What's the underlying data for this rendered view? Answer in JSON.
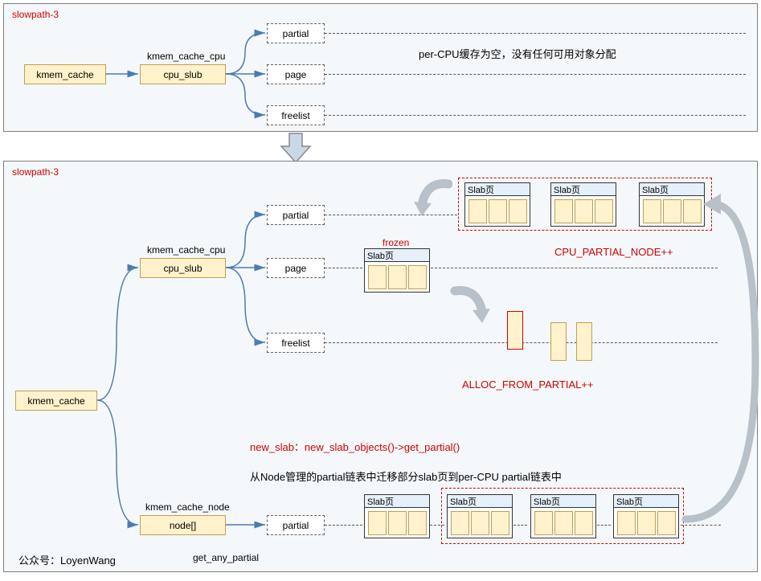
{
  "top": {
    "title": "slowpath-3",
    "kmem_cache": "kmem_cache",
    "kmem_cache_cpu": "kmem_cache_cpu",
    "cpu_slub": "cpu_slub",
    "partial": "partial",
    "page": "page",
    "freelist": "freelist",
    "caption": "per-CPU缓存为空，没有任何可用对象分配"
  },
  "bot": {
    "title": "slowpath-3",
    "kmem_cache": "kmem_cache",
    "kmem_cache_cpu": "kmem_cache_cpu",
    "cpu_slub": "cpu_slub",
    "kmem_cache_node": "kmem_cache_node",
    "node_arr": "node[]",
    "partial": "partial",
    "page": "page",
    "freelist": "freelist",
    "frozen": "frozen",
    "slab_label": "Slab页",
    "cpu_partial_node": "CPU_PARTIAL_NODE++",
    "alloc_from_partial": "ALLOC_FROM_PARTIAL++",
    "new_slab_line": "new_slab：new_slab_objects()->get_partial()",
    "node_partial_caption": "从Node管理的partial链表中迁移部分slab页到per-CPU partial链表中",
    "get_any_partial": "get_any_partial",
    "watermark": "公众号：LoyenWang"
  }
}
